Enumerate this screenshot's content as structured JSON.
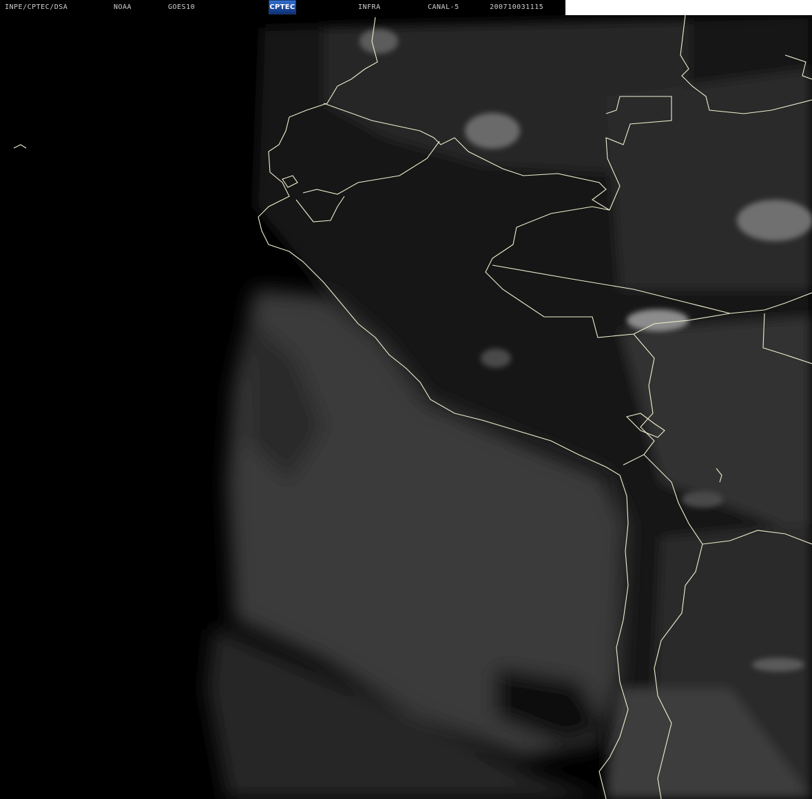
{
  "header": {
    "institution": "INPE/CPTEC/DSA",
    "agency": "NOAA",
    "satellite": "GOES10",
    "logo_text": "CPTEC",
    "band": "INFRA",
    "channel": "CANAL-5",
    "timestamp": "200710031115"
  },
  "colors": {
    "background": "#000000",
    "header_text": "#cfcfcf",
    "border_lines": "#f3f0d2",
    "cloud_gray": "#3a3a3a",
    "bright_cloud": "#9a9a9a",
    "logo_blue": "#2f6fd1",
    "blank_box": "#ffffff"
  },
  "map": {
    "type": "satellite infrared image",
    "region": "western South America and Pacific Ocean"
  }
}
